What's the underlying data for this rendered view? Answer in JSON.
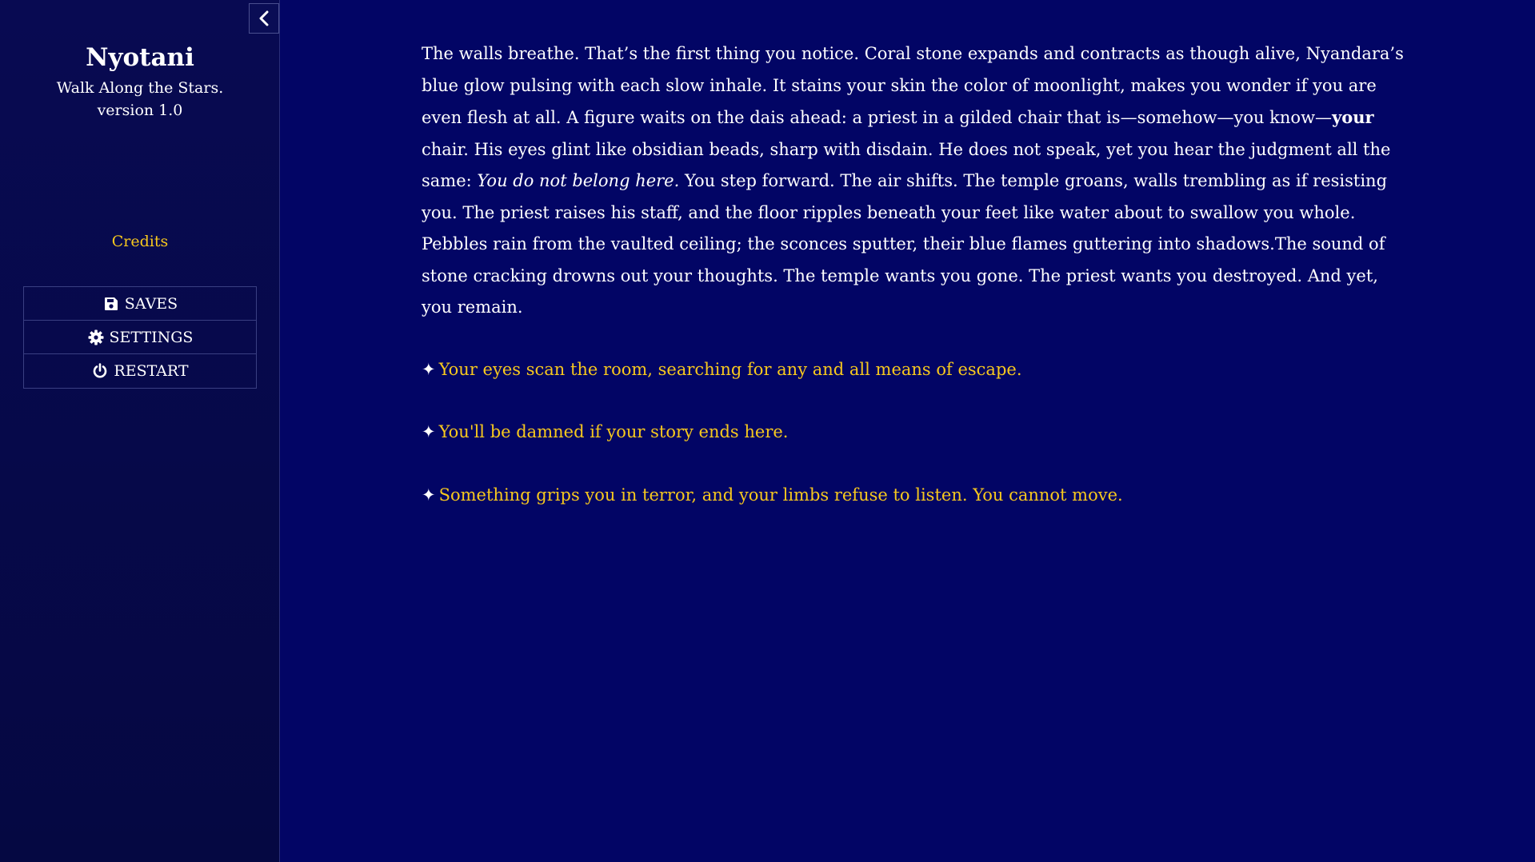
{
  "sidebar": {
    "title": "Nyotani",
    "subtitle": "Walk Along the Stars.",
    "version": "version 1.0",
    "credits_label": "Credits",
    "menu": [
      {
        "label": "SAVES",
        "icon": "floppy-disk-icon"
      },
      {
        "label": "SETTINGS",
        "icon": "gear-icon"
      },
      {
        "label": "RESTART",
        "icon": "power-icon"
      }
    ]
  },
  "passage": {
    "text_part1": "The walls breathe. That’s the first thing you notice. Coral stone expands and contracts as though alive, Nyandara’s blue glow pulsing with each slow inhale. It stains your skin the color of moonlight, makes you wonder if you are even flesh at all. A figure waits on the dais ahead: a priest in a gilded chair that is—somehow—you know—",
    "bold_word": "your",
    "text_part2": " chair. His eyes glint like obsidian beads, sharp with disdain. He does not speak, yet you hear the judgment all the same: ",
    "italic_phrase": "You do not belong here.",
    "text_part3": " You step forward. The air shifts. The temple groans, walls trembling as if resisting you. The priest raises his staff, and the floor ripples beneath your feet like water about to swallow you whole. Pebbles rain from the vaulted ceiling; the sconces sputter, their blue flames guttering into shadows.The sound of stone cracking drowns out your thoughts. The temple wants you gone. The priest wants you destroyed. And yet, you remain.",
    "choice_marker": "✦",
    "choices": [
      "Your eyes scan the room, searching for any and all means of escape.",
      "You'll be damned if your story ends here.",
      "Something grips you in terror, and your limbs refuse to listen. You cannot move."
    ]
  },
  "colors": {
    "background": "#020565",
    "sidebar": "#060946",
    "link": "#f7c81e",
    "text": "#ffffff"
  }
}
